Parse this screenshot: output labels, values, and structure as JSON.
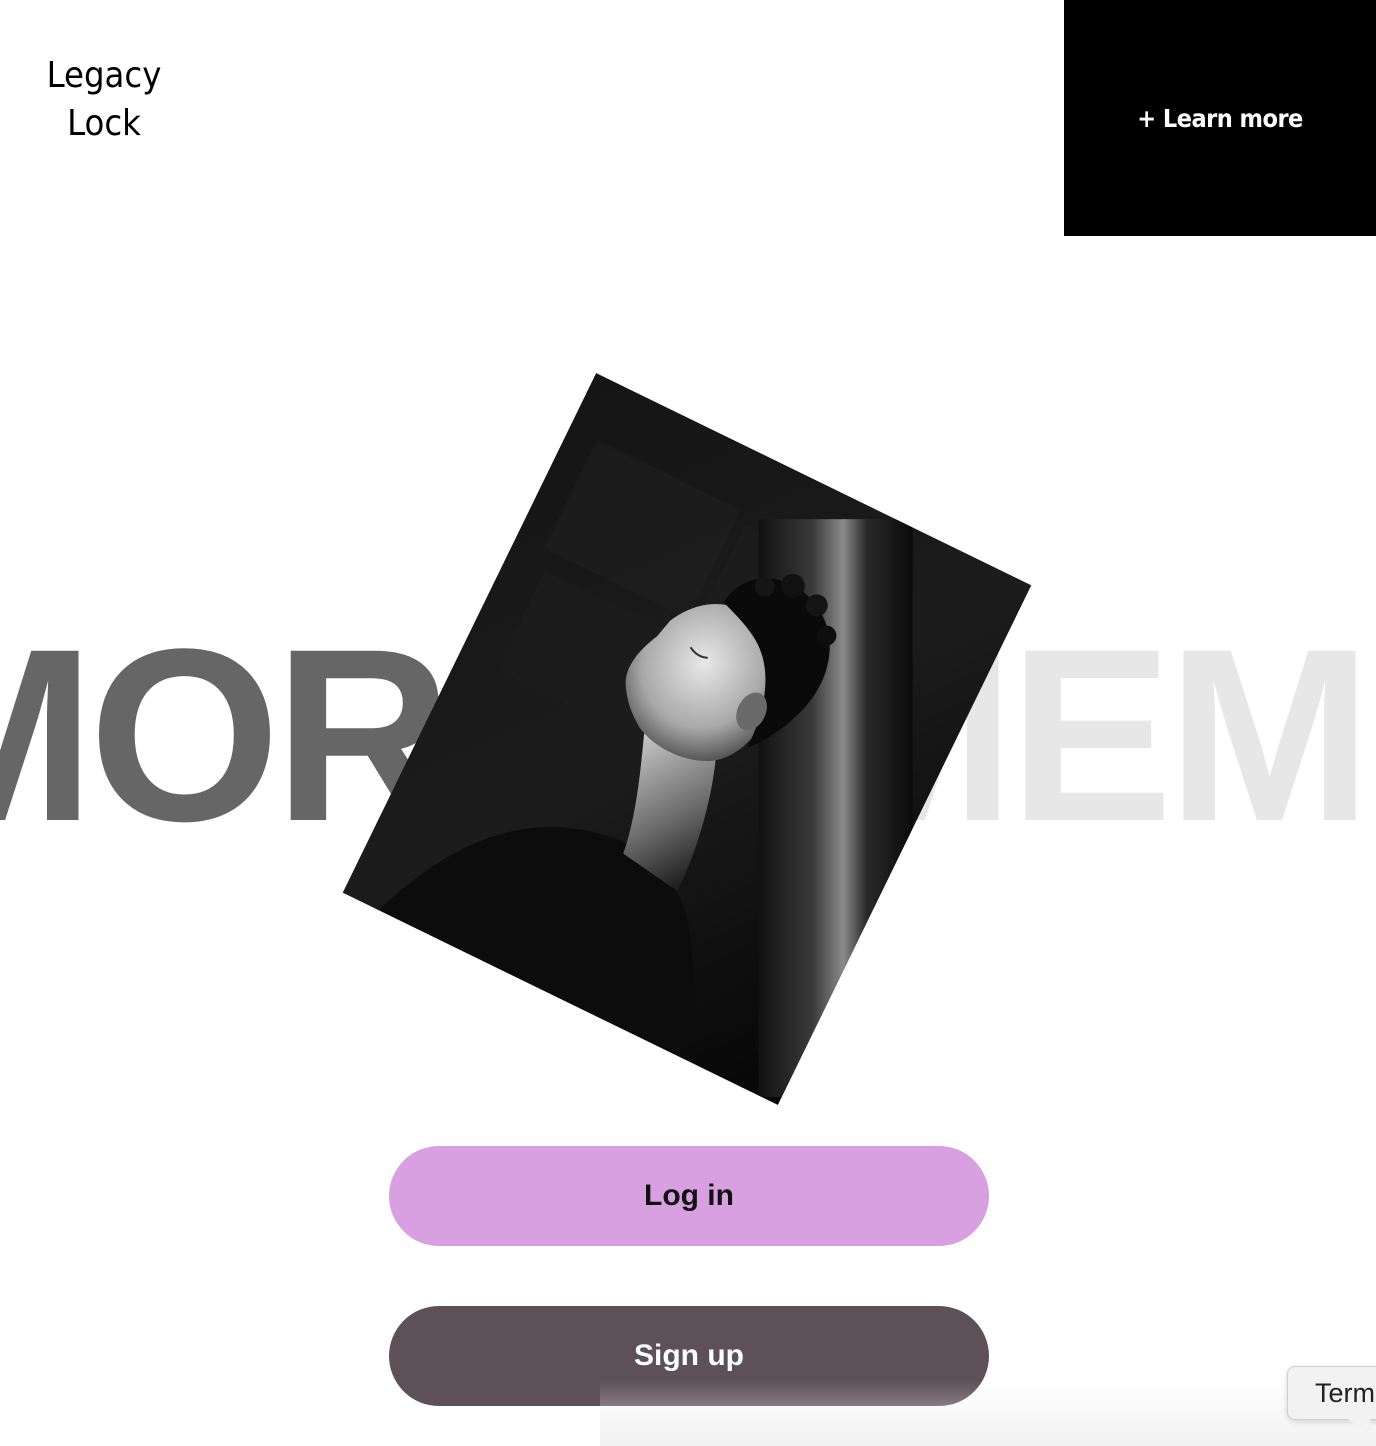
{
  "brand": {
    "line1": "Legacy",
    "line2": "Lock"
  },
  "header": {
    "learn_more_label": "+ Learn more"
  },
  "hero": {
    "marquee_left": "MORI",
    "marquee_right": "MEM",
    "photo_alt": "Black and white portrait of a person with eyes closed, head tilted back against a wall"
  },
  "actions": {
    "login_label": "Log in",
    "signup_label": "Sign up"
  },
  "footer": {
    "terms_label": "Terms"
  },
  "colors": {
    "login_bg": "#d8a0e0",
    "signup_bg": "#5d5057",
    "header_box_bg": "#000000",
    "marquee_dark": "#666666",
    "marquee_light": "#e7e7e7"
  }
}
